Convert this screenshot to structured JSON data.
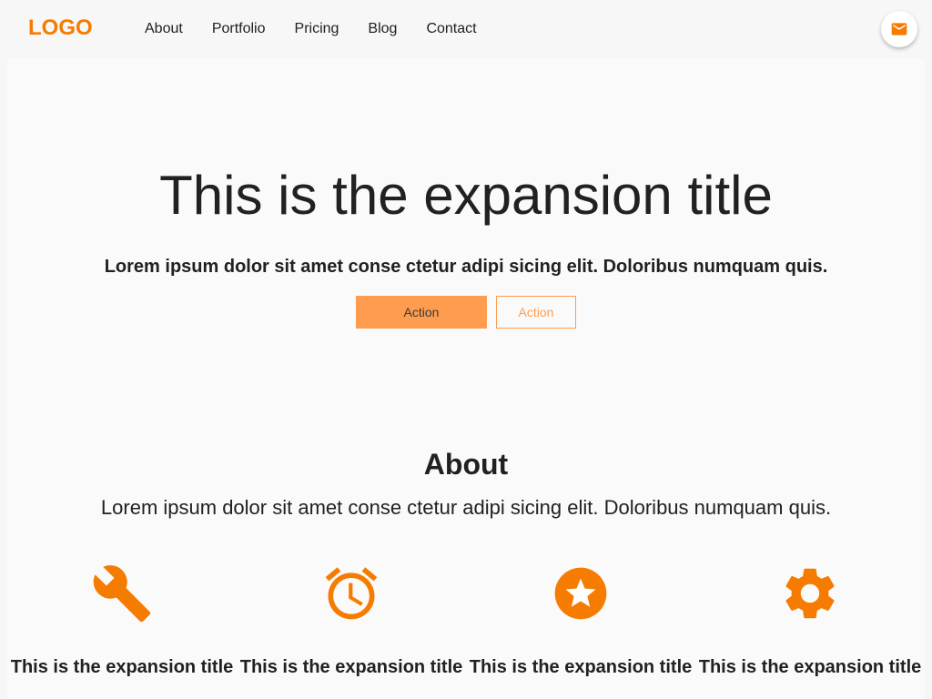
{
  "nav": {
    "logo": "LOGO",
    "links": [
      {
        "label": "About"
      },
      {
        "label": "Portfolio"
      },
      {
        "label": "Pricing"
      },
      {
        "label": "Blog"
      },
      {
        "label": "Contact"
      }
    ],
    "fab_icon": "mail-icon"
  },
  "hero": {
    "title": "This is the expansion title",
    "subtitle": "Lorem ipsum dolor sit amet conse ctetur adipi sicing elit. Doloribus numquam quis.",
    "primary_action": "Action",
    "secondary_action": "Action"
  },
  "about": {
    "title": "About",
    "text": "Lorem ipsum dolor sit amet conse ctetur adipi sicing elit. Doloribus numquam quis."
  },
  "features": [
    {
      "icon": "wrench-icon",
      "title": "This is the expansion title"
    },
    {
      "icon": "alarm-clock-icon",
      "title": "This is the expansion title"
    },
    {
      "icon": "star-circle-icon",
      "title": "This is the expansion title"
    },
    {
      "icon": "gear-icon",
      "title": "This is the expansion title"
    }
  ],
  "colors": {
    "accent": "#f57c00",
    "button": "#ff9c4f"
  }
}
